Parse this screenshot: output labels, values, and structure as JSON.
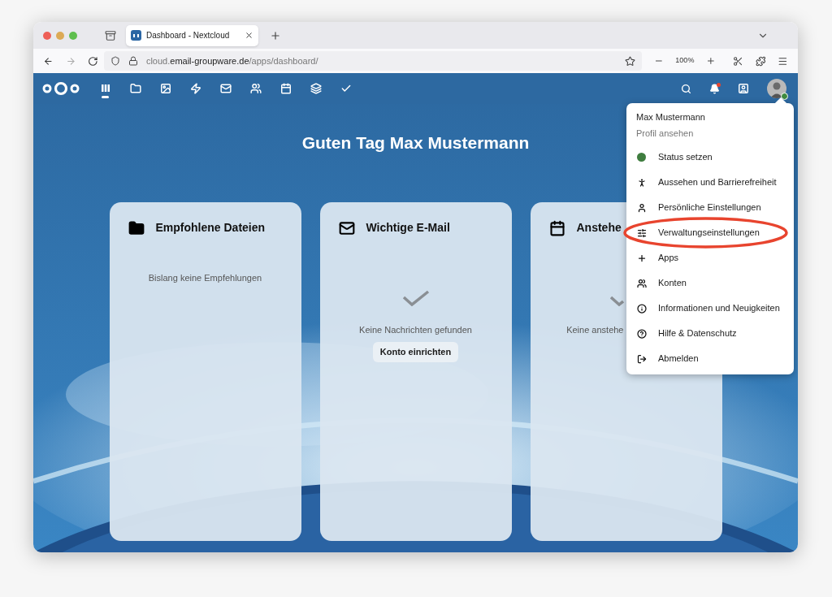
{
  "browser": {
    "tab_title": "Dashboard - Nextcloud",
    "url": {
      "scheme_host_prefix": "cloud.",
      "domain": "email-groupware.de",
      "path": "/apps/dashboard/"
    },
    "zoom": "100%"
  },
  "header": {
    "apps": [
      {
        "kind": "dashboard",
        "selected": true
      },
      {
        "kind": "files",
        "selected": false
      },
      {
        "kind": "photos",
        "selected": false
      },
      {
        "kind": "activity",
        "selected": false
      },
      {
        "kind": "mail",
        "selected": false
      },
      {
        "kind": "contacts",
        "selected": false
      },
      {
        "kind": "calendar",
        "selected": false
      },
      {
        "kind": "deck",
        "selected": false
      },
      {
        "kind": "tasks",
        "selected": false
      }
    ],
    "notifications_unread": true,
    "user_online": true
  },
  "greeting": "Guten Tag Max Mustermann",
  "widgets": [
    {
      "kind": "files",
      "title": "Empfohlene Dateien",
      "empty_text": "Bislang keine Empfehlungen",
      "check": false
    },
    {
      "kind": "mail",
      "title": "Wichtige E-Mail",
      "empty_text": "Keine Nachrichten gefunden",
      "check": true,
      "button": "Konto einrichten"
    },
    {
      "kind": "calendar",
      "title": "Anstehe",
      "empty_text": "Keine anstehe",
      "check": true
    }
  ],
  "user_menu": {
    "name": "Max Mustermann",
    "subtitle": "Profil ansehen",
    "items": [
      {
        "kind": "status",
        "label": "Status setzen",
        "color": "#3f7d3f",
        "highlighted": false
      },
      {
        "kind": "appearance",
        "label": "Aussehen und Barrierefreiheit",
        "highlighted": false
      },
      {
        "kind": "personal",
        "label": "Persönliche Einstellungen",
        "highlighted": false
      },
      {
        "kind": "admin",
        "label": "Verwaltungseinstellungen",
        "highlighted": true
      },
      {
        "kind": "apps",
        "label": "Apps",
        "highlighted": false
      },
      {
        "kind": "accounts",
        "label": "Konten",
        "highlighted": false
      },
      {
        "kind": "info",
        "label": "Informationen und Neuigkeiten",
        "highlighted": false
      },
      {
        "kind": "help",
        "label": "Hilfe & Datenschutz",
        "highlighted": false
      },
      {
        "kind": "logout",
        "label": "Abmelden",
        "highlighted": false
      }
    ]
  }
}
